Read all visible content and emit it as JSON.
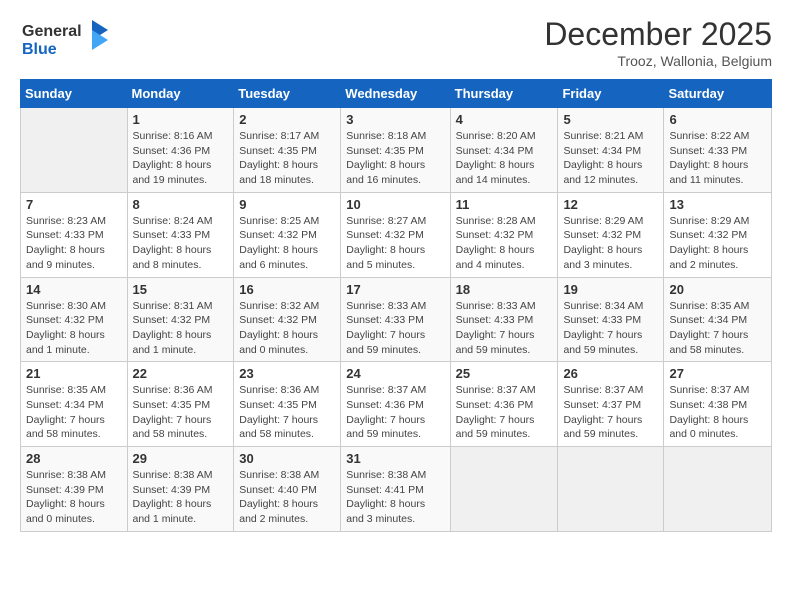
{
  "logo": {
    "line1": "General",
    "line2": "Blue"
  },
  "header": {
    "month": "December 2025",
    "location": "Trooz, Wallonia, Belgium"
  },
  "weekdays": [
    "Sunday",
    "Monday",
    "Tuesday",
    "Wednesday",
    "Thursday",
    "Friday",
    "Saturday"
  ],
  "weeks": [
    [
      {
        "day": "",
        "info": ""
      },
      {
        "day": "1",
        "info": "Sunrise: 8:16 AM\nSunset: 4:36 PM\nDaylight: 8 hours\nand 19 minutes."
      },
      {
        "day": "2",
        "info": "Sunrise: 8:17 AM\nSunset: 4:35 PM\nDaylight: 8 hours\nand 18 minutes."
      },
      {
        "day": "3",
        "info": "Sunrise: 8:18 AM\nSunset: 4:35 PM\nDaylight: 8 hours\nand 16 minutes."
      },
      {
        "day": "4",
        "info": "Sunrise: 8:20 AM\nSunset: 4:34 PM\nDaylight: 8 hours\nand 14 minutes."
      },
      {
        "day": "5",
        "info": "Sunrise: 8:21 AM\nSunset: 4:34 PM\nDaylight: 8 hours\nand 12 minutes."
      },
      {
        "day": "6",
        "info": "Sunrise: 8:22 AM\nSunset: 4:33 PM\nDaylight: 8 hours\nand 11 minutes."
      }
    ],
    [
      {
        "day": "7",
        "info": "Sunrise: 8:23 AM\nSunset: 4:33 PM\nDaylight: 8 hours\nand 9 minutes."
      },
      {
        "day": "8",
        "info": "Sunrise: 8:24 AM\nSunset: 4:33 PM\nDaylight: 8 hours\nand 8 minutes."
      },
      {
        "day": "9",
        "info": "Sunrise: 8:25 AM\nSunset: 4:32 PM\nDaylight: 8 hours\nand 6 minutes."
      },
      {
        "day": "10",
        "info": "Sunrise: 8:27 AM\nSunset: 4:32 PM\nDaylight: 8 hours\nand 5 minutes."
      },
      {
        "day": "11",
        "info": "Sunrise: 8:28 AM\nSunset: 4:32 PM\nDaylight: 8 hours\nand 4 minutes."
      },
      {
        "day": "12",
        "info": "Sunrise: 8:29 AM\nSunset: 4:32 PM\nDaylight: 8 hours\nand 3 minutes."
      },
      {
        "day": "13",
        "info": "Sunrise: 8:29 AM\nSunset: 4:32 PM\nDaylight: 8 hours\nand 2 minutes."
      }
    ],
    [
      {
        "day": "14",
        "info": "Sunrise: 8:30 AM\nSunset: 4:32 PM\nDaylight: 8 hours\nand 1 minute."
      },
      {
        "day": "15",
        "info": "Sunrise: 8:31 AM\nSunset: 4:32 PM\nDaylight: 8 hours\nand 1 minute."
      },
      {
        "day": "16",
        "info": "Sunrise: 8:32 AM\nSunset: 4:32 PM\nDaylight: 8 hours\nand 0 minutes."
      },
      {
        "day": "17",
        "info": "Sunrise: 8:33 AM\nSunset: 4:33 PM\nDaylight: 7 hours\nand 59 minutes."
      },
      {
        "day": "18",
        "info": "Sunrise: 8:33 AM\nSunset: 4:33 PM\nDaylight: 7 hours\nand 59 minutes."
      },
      {
        "day": "19",
        "info": "Sunrise: 8:34 AM\nSunset: 4:33 PM\nDaylight: 7 hours\nand 59 minutes."
      },
      {
        "day": "20",
        "info": "Sunrise: 8:35 AM\nSunset: 4:34 PM\nDaylight: 7 hours\nand 58 minutes."
      }
    ],
    [
      {
        "day": "21",
        "info": "Sunrise: 8:35 AM\nSunset: 4:34 PM\nDaylight: 7 hours\nand 58 minutes."
      },
      {
        "day": "22",
        "info": "Sunrise: 8:36 AM\nSunset: 4:35 PM\nDaylight: 7 hours\nand 58 minutes."
      },
      {
        "day": "23",
        "info": "Sunrise: 8:36 AM\nSunset: 4:35 PM\nDaylight: 7 hours\nand 58 minutes."
      },
      {
        "day": "24",
        "info": "Sunrise: 8:37 AM\nSunset: 4:36 PM\nDaylight: 7 hours\nand 59 minutes."
      },
      {
        "day": "25",
        "info": "Sunrise: 8:37 AM\nSunset: 4:36 PM\nDaylight: 7 hours\nand 59 minutes."
      },
      {
        "day": "26",
        "info": "Sunrise: 8:37 AM\nSunset: 4:37 PM\nDaylight: 7 hours\nand 59 minutes."
      },
      {
        "day": "27",
        "info": "Sunrise: 8:37 AM\nSunset: 4:38 PM\nDaylight: 8 hours\nand 0 minutes."
      }
    ],
    [
      {
        "day": "28",
        "info": "Sunrise: 8:38 AM\nSunset: 4:39 PM\nDaylight: 8 hours\nand 0 minutes."
      },
      {
        "day": "29",
        "info": "Sunrise: 8:38 AM\nSunset: 4:39 PM\nDaylight: 8 hours\nand 1 minute."
      },
      {
        "day": "30",
        "info": "Sunrise: 8:38 AM\nSunset: 4:40 PM\nDaylight: 8 hours\nand 2 minutes."
      },
      {
        "day": "31",
        "info": "Sunrise: 8:38 AM\nSunset: 4:41 PM\nDaylight: 8 hours\nand 3 minutes."
      },
      {
        "day": "",
        "info": ""
      },
      {
        "day": "",
        "info": ""
      },
      {
        "day": "",
        "info": ""
      }
    ]
  ]
}
